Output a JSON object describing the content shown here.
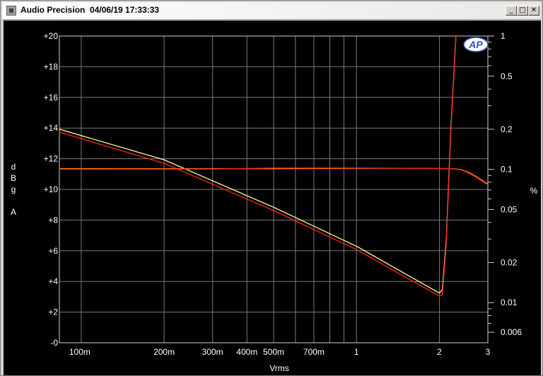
{
  "window": {
    "title": "Audio Precision  04/06/19 17:33:33",
    "minimize_label": "_",
    "maximize_label": "□",
    "close_label": "✕"
  },
  "chart_data": {
    "type": "line",
    "title": "",
    "xlabel": "Vrms",
    "ylabel_left": [
      "d",
      "B",
      "g",
      "",
      "A"
    ],
    "ylabel_right": "%",
    "x_scale": "log",
    "xlim": [
      0.0833,
      3.0
    ],
    "ylim_left": [
      0,
      20
    ],
    "right_scale": "log",
    "ylim_right": [
      0.005,
      1.0
    ],
    "grid": true,
    "logo_text": "AP",
    "x_ticks": [
      {
        "v": 0.1,
        "label": "100m"
      },
      {
        "v": 0.2,
        "label": "200m"
      },
      {
        "v": 0.3,
        "label": "300m"
      },
      {
        "v": 0.4,
        "label": "400m"
      },
      {
        "v": 0.5,
        "label": "500m"
      },
      {
        "v": 0.6,
        "label": ""
      },
      {
        "v": 0.7,
        "label": "700m"
      },
      {
        "v": 0.8,
        "label": ""
      },
      {
        "v": 0.9,
        "label": ""
      },
      {
        "v": 1.0,
        "label": "1"
      },
      {
        "v": 2.0,
        "label": "2"
      },
      {
        "v": 3.0,
        "label": "3"
      }
    ],
    "y_left_ticks": [
      {
        "v": 0,
        "label": "-0"
      },
      {
        "v": 2,
        "label": "+2"
      },
      {
        "v": 4,
        "label": "+4"
      },
      {
        "v": 6,
        "label": "+6"
      },
      {
        "v": 8,
        "label": "+8"
      },
      {
        "v": 10,
        "label": "+10"
      },
      {
        "v": 12,
        "label": "+12"
      },
      {
        "v": 14,
        "label": "+14"
      },
      {
        "v": 16,
        "label": "+16"
      },
      {
        "v": 18,
        "label": "+18"
      },
      {
        "v": 20,
        "label": "+20"
      }
    ],
    "y_right_ticks": [
      {
        "v": 1.0,
        "label": "1"
      },
      {
        "v": 0.5,
        "label": "0.5"
      },
      {
        "v": 0.2,
        "label": "0.2"
      },
      {
        "v": 0.1,
        "label": "0.1"
      },
      {
        "v": 0.05,
        "label": "0.05"
      },
      {
        "v": 0.02,
        "label": "0.02"
      },
      {
        "v": 0.01,
        "label": "0.01"
      },
      {
        "v": 0.006,
        "label": "0.006"
      }
    ],
    "y_right_minor_ticks": [
      0.9,
      0.8,
      0.7,
      0.6,
      0.4,
      0.3,
      0.09,
      0.08,
      0.07,
      0.06,
      0.04,
      0.03,
      0.009,
      0.008,
      0.007
    ],
    "series": [
      {
        "axis": "right",
        "color": "#ffff99",
        "x": [
          0.0833,
          0.2,
          0.5,
          1.0,
          2.0,
          2.05,
          2.12,
          2.2,
          2.3,
          2.4
        ],
        "y": [
          0.2,
          0.118,
          0.052,
          0.0265,
          0.0118,
          0.0125,
          0.03,
          0.2,
          1.05,
          2.0
        ]
      },
      {
        "axis": "right",
        "color": "#ff2020",
        "x": [
          0.0833,
          0.2,
          0.5,
          1.0,
          2.0,
          2.05,
          2.12,
          2.2,
          2.3,
          2.4
        ],
        "y": [
          0.19,
          0.111,
          0.049,
          0.025,
          0.0112,
          0.0114,
          0.028,
          0.19,
          1.02,
          2.0
        ]
      },
      {
        "axis": "left",
        "color": "#ff9900",
        "x": [
          0.0833,
          0.5,
          1.0,
          1.5,
          2.2,
          2.4,
          2.6,
          2.8,
          3.0
        ],
        "y": [
          11.35,
          11.35,
          11.38,
          11.38,
          11.36,
          11.3,
          11.05,
          10.7,
          10.35
        ]
      },
      {
        "axis": "left",
        "color": "#ff2020",
        "x": [
          0.0833,
          0.3,
          0.5,
          1.0,
          1.5,
          2.2,
          2.4,
          2.6,
          2.8,
          3.0
        ],
        "y": [
          11.32,
          11.33,
          11.39,
          11.4,
          11.38,
          11.35,
          11.28,
          11.0,
          10.65,
          10.3
        ]
      }
    ]
  }
}
